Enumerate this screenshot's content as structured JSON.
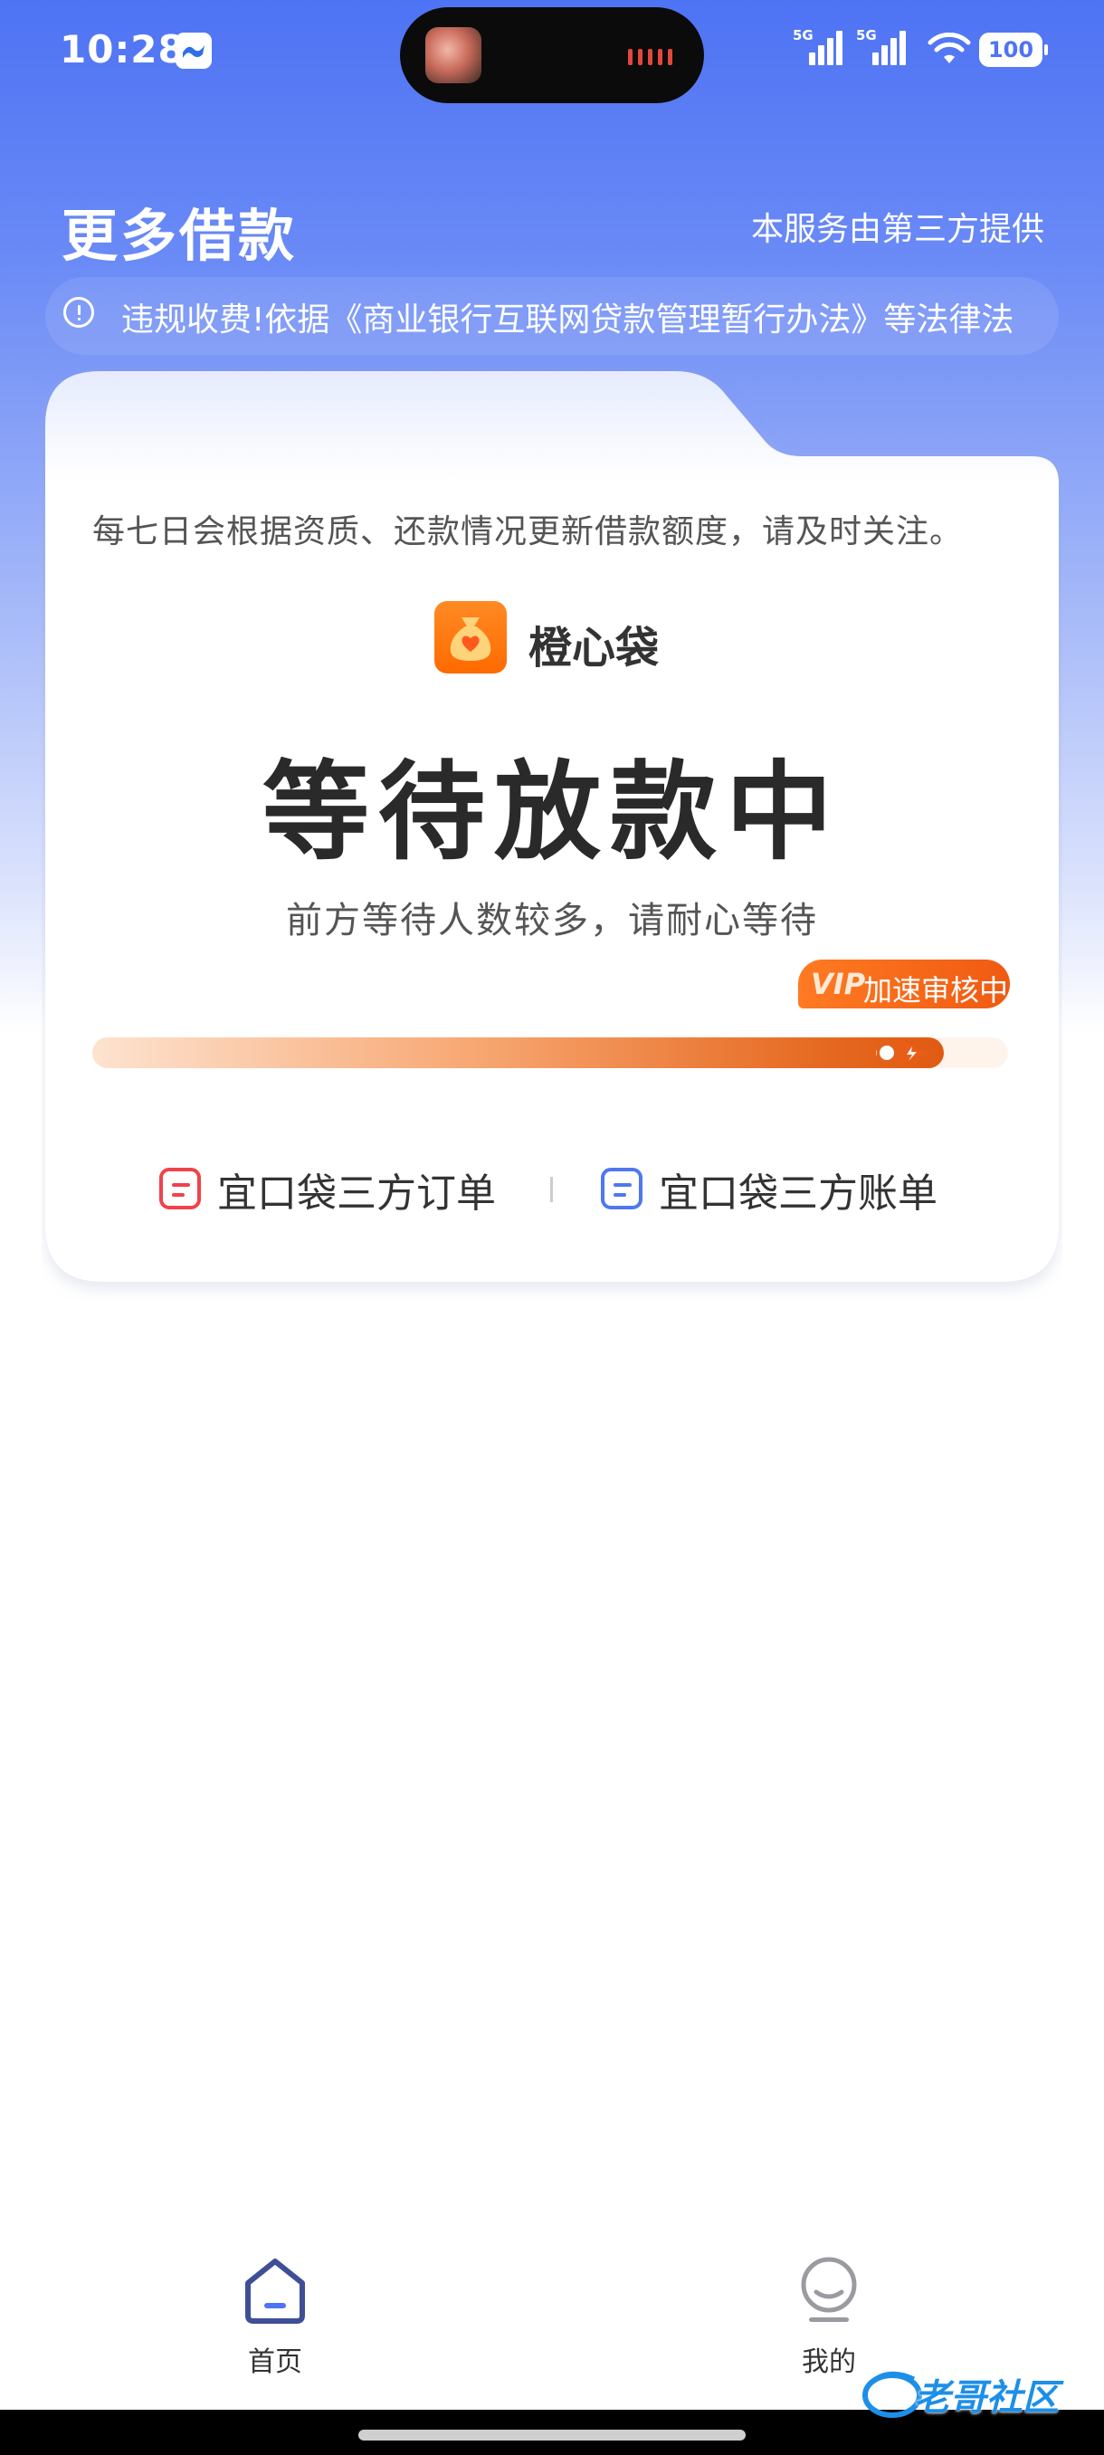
{
  "status_bar": {
    "time": "10:28",
    "signal_1_label": "5G",
    "signal_2_label": "5G",
    "battery": "100"
  },
  "header": {
    "title": "更多借款",
    "provider_note": "本服务由第三方提供"
  },
  "notice": {
    "icon": "info-circle-icon",
    "text": "违规收费!依据《商业银行互联网贷款管理暂行办法》等法律法"
  },
  "card": {
    "info_text": "每七日会根据资质、还款情况更新借款额度，请及时关注。",
    "brand_name": "橙心袋",
    "status": "等待放款中",
    "status_sub": "前方等待人数较多，请耐心等待",
    "vip_tag": "VIP",
    "vip_label": "加速审核中",
    "progress": 0.93,
    "links": {
      "order": "宜口袋三方订单",
      "bill": "宜口袋三方账单"
    }
  },
  "tabbar": {
    "home": "首页",
    "mine": "我的"
  },
  "watermark": "老哥社区",
  "colors": {
    "accent_blue": "#4e73f4",
    "brand_orange": "#ff6a00",
    "order_red": "#f0424a",
    "bill_blue": "#4f77f0"
  }
}
